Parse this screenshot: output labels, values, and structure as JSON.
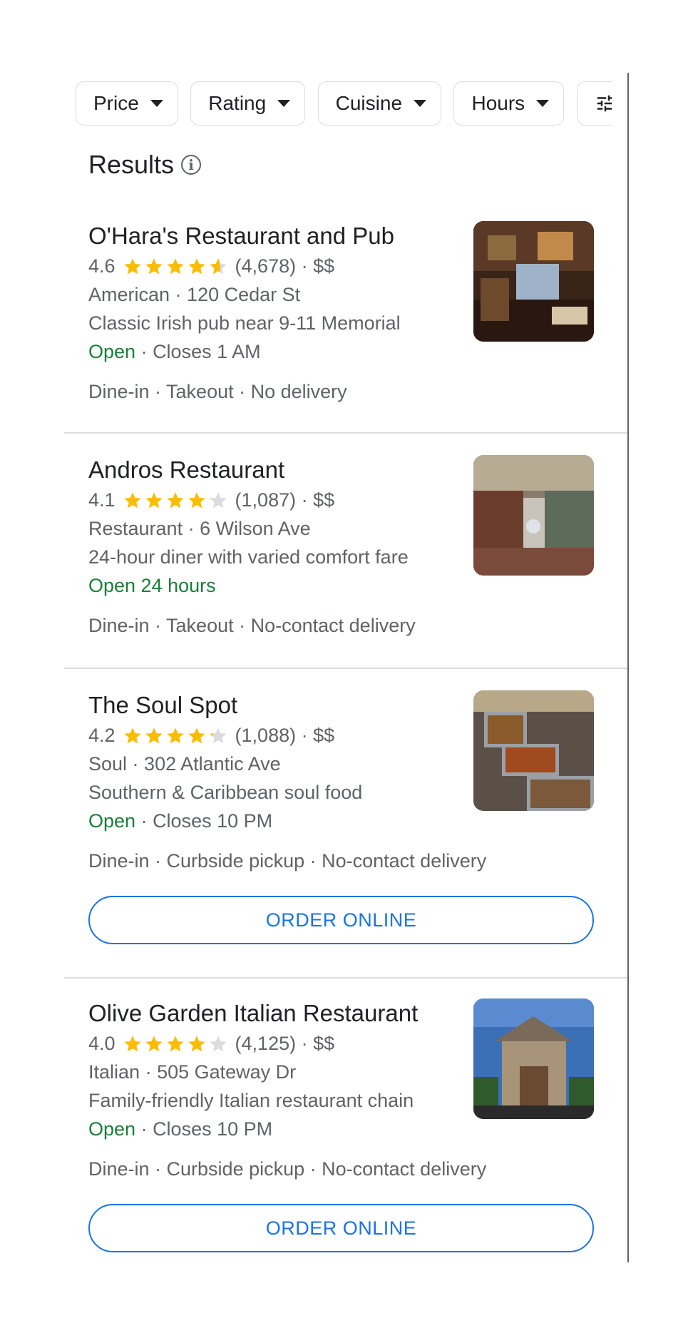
{
  "filters": [
    {
      "label": "Price"
    },
    {
      "label": "Rating"
    },
    {
      "label": "Cuisine"
    },
    {
      "label": "Hours"
    }
  ],
  "results_title": "Results",
  "colors": {
    "open": "#188038",
    "star": "#fbbc04",
    "accent": "#1a73e8"
  },
  "results": [
    {
      "name": "O'Hara's Restaurant and Pub",
      "rating": "4.6",
      "rating_value": 4.6,
      "reviews": "(4,678)",
      "price": "$$",
      "category": "American",
      "address": "120 Cedar St",
      "description": "Classic Irish pub near 9-11 Memorial",
      "status": "Open",
      "hours": "Closes 1 AM",
      "services": "Dine-in · Takeout · No delivery"
    },
    {
      "name": "Andros Restaurant",
      "rating": "4.1",
      "rating_value": 4.1,
      "reviews": "(1,087)",
      "price": "$$",
      "category": "Restaurant",
      "address": "6 Wilson Ave",
      "description": "24-hour diner with varied comfort fare",
      "status": "Open 24 hours",
      "hours": "",
      "services": "Dine-in · Takeout · No-contact delivery"
    },
    {
      "name": "The Soul Spot",
      "rating": "4.2",
      "rating_value": 4.2,
      "reviews": "(1,088)",
      "price": "$$",
      "category": "Soul",
      "address": "302 Atlantic Ave",
      "description": "Southern & Caribbean soul food",
      "status": "Open",
      "hours": "Closes 10 PM",
      "services": "Dine-in · Curbside pickup · No-contact delivery",
      "order_label": "ORDER ONLINE"
    },
    {
      "name": "Olive Garden Italian Restaurant",
      "rating": "4.0",
      "rating_value": 4.0,
      "reviews": "(4,125)",
      "price": "$$",
      "category": "Italian",
      "address": "505 Gateway Dr",
      "description": "Family-friendly Italian restaurant chain",
      "status": "Open",
      "hours": "Closes 10 PM",
      "services": "Dine-in · Curbside pickup · No-contact delivery",
      "order_label": "ORDER ONLINE"
    }
  ]
}
